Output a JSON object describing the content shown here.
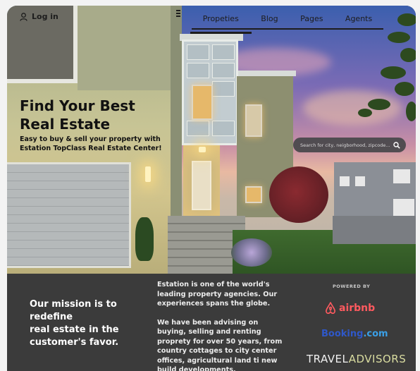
{
  "nav": {
    "login_label": "Log in",
    "items": [
      {
        "label": "Propeties",
        "active": true
      },
      {
        "label": "Blog",
        "active": false
      },
      {
        "label": "Pages",
        "active": false
      },
      {
        "label": "Agents",
        "active": false
      }
    ]
  },
  "hero": {
    "headline_line1": "Find Your Best",
    "headline_line2": "Real Estate",
    "subtitle_line1": "Easy to buy & sell your property with",
    "subtitle_line2": "Estation TopClass Real Estate Center!",
    "search_placeholder": "Search for city, neigborhood, zipcode...",
    "icons": [
      "user-icon",
      "search-icon"
    ]
  },
  "info": {
    "mission_line1": "Our mission is to redefine",
    "mission_line2": "real estate in the",
    "mission_line3": "customer's favor.",
    "about_p1": "Estation is one of the world's leading property agencies. Our experiences spans the globe.",
    "about_p2": "We have been advising on buying, selling and renting proprety for over 50 years, from country cottages to city center offices, agricultural land ti new build developments."
  },
  "partners": {
    "powered_by": "POWERED BY",
    "airbnb": "airbnb",
    "booking_main": "Booking",
    "booking_suffix": ".com",
    "travel_left": "TRAVEL",
    "travel_right": "ADVISORS"
  },
  "colors": {
    "airbnb": "#ff5a5f",
    "booking": "#2f58c9",
    "bottom_bg": "#3b3b3b"
  }
}
